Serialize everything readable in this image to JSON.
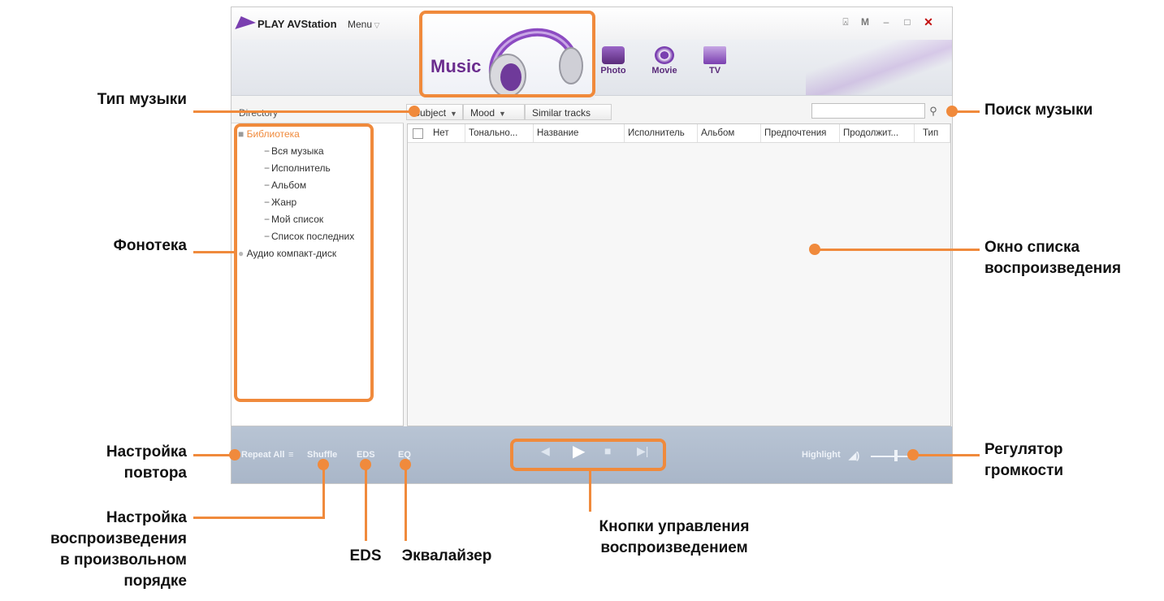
{
  "app": {
    "title": "PLAY AVStation",
    "menu_label": "Menu",
    "window_buttons": [
      "⍓",
      "M",
      "–",
      "□",
      "✕"
    ]
  },
  "header": {
    "active_tab": "Music",
    "tabs": [
      {
        "label": "Photo",
        "icon": "photo-icon"
      },
      {
        "label": "Movie",
        "icon": "movie-icon"
      },
      {
        "label": "TV",
        "icon": "tv-icon"
      }
    ]
  },
  "directory": {
    "title": "Directory",
    "root": "Библиотека",
    "items": [
      "Вся музыка",
      "Исполнитель",
      "Альбом",
      "Жанр",
      "Мой список",
      "Список последних"
    ],
    "audio_cd": "Аудио компакт-диск"
  },
  "toolbar": {
    "subject": "Subject",
    "mood": "Mood",
    "similar": "Similar tracks",
    "search_value": ""
  },
  "playlist": {
    "columns": [
      "Нет",
      "Тонально...",
      "Название",
      "Исполнитель",
      "Альбом",
      "Предпочтения",
      "Продолжит...",
      "Тип"
    ]
  },
  "controls": {
    "repeat": "Repeat All",
    "shuffle": "Shuffle",
    "eds": "EDS",
    "eq": "EQ",
    "highlight": "Highlight",
    "volume_level": 0.65
  },
  "annotations": {
    "music_type": "Тип музыки",
    "library": "Фонотека",
    "repeat_line1": "Настройка",
    "repeat_line2": "повтора",
    "shuffle_line1": "Настройка",
    "shuffle_line2": "воспроизведения",
    "shuffle_line3": "в произвольном",
    "shuffle_line4": "порядке",
    "eds": "EDS",
    "equalizer": "Эквалайзер",
    "playback_line1": "Кнопки управления",
    "playback_line2": "воспроизведением",
    "search": "Поиск музыки",
    "playlist_line1": "Окно списка",
    "playlist_line2": "воспроизведения",
    "volume_line1": "Регулятор",
    "volume_line2": "громкости"
  },
  "colors": {
    "annotation": "#f08a3c",
    "accent": "#6b2d8e",
    "library_root": "#f08a3c",
    "control_bar": "#aebbcc"
  }
}
